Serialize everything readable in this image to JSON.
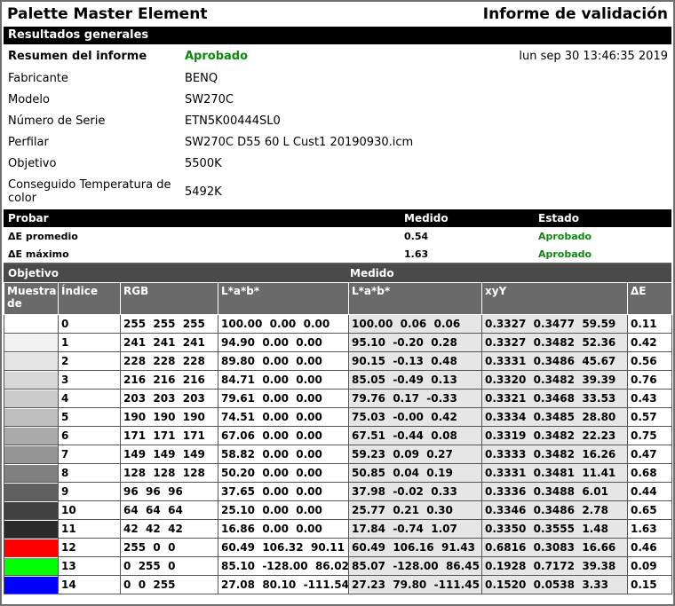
{
  "header": {
    "app_title": "Palette Master Element",
    "report_title": "Informe de validación"
  },
  "general": {
    "band_label": "Resultados generales",
    "summary_label": "Resumen del informe",
    "summary_status": "Aprobado",
    "date": "lun sep 30 13:46:35 2019",
    "fields": [
      {
        "label": "Fabricante",
        "value": "BENQ"
      },
      {
        "label": "Modelo",
        "value": "SW270C"
      },
      {
        "label": "Número de Serie",
        "value": "ETN5K00444SL0"
      },
      {
        "label": "Perfilar",
        "value": "SW270C D55 60 L Cust1 20190930.icm"
      },
      {
        "label": "Objetivo",
        "value": "5500K"
      },
      {
        "label": "Conseguido Temperatura de color",
        "value": "5492K"
      }
    ]
  },
  "tests": {
    "headers": {
      "test": "Probar",
      "measured": "Medido",
      "status": "Estado"
    },
    "rows": [
      {
        "name": "ΔE promedio",
        "measured": "0.54",
        "status": "Aprobado"
      },
      {
        "name": "ΔE máximo",
        "measured": "1.63",
        "status": "Aprobado"
      }
    ]
  },
  "samples": {
    "group_target": "Objetivo",
    "group_measured": "Medido",
    "columns": [
      "Muestra de",
      "Índice",
      "RGB",
      "L*a*b*",
      "L*a*b*",
      "xyY",
      "ΔE"
    ],
    "colors": {
      "red": "#ff0000",
      "green": "#00ff00",
      "blue": "#0000ff"
    },
    "rows": [
      {
        "swatch": "#ffffff",
        "index": "0",
        "rgb": "255  255  255",
        "lab_t": "100.00  0.00  0.00",
        "lab_m": "100.00  0.06  0.06",
        "xyy": "0.3327  0.3477  59.59",
        "de": "0.11"
      },
      {
        "swatch": "#f1f1f1",
        "index": "1",
        "rgb": "241  241  241",
        "lab_t": "94.90  0.00  0.00",
        "lab_m": "95.10  -0.20  0.28",
        "xyy": "0.3327  0.3482  52.36",
        "de": "0.42"
      },
      {
        "swatch": "#e4e4e4",
        "index": "2",
        "rgb": "228  228  228",
        "lab_t": "89.80  0.00  0.00",
        "lab_m": "90.15  -0.13  0.48",
        "xyy": "0.3331  0.3486  45.67",
        "de": "0.56"
      },
      {
        "swatch": "#d8d8d8",
        "index": "3",
        "rgb": "216  216  216",
        "lab_t": "84.71  0.00  0.00",
        "lab_m": "85.05  -0.49  0.13",
        "xyy": "0.3320  0.3482  39.39",
        "de": "0.76"
      },
      {
        "swatch": "#cbcbcb",
        "index": "4",
        "rgb": "203  203  203",
        "lab_t": "79.61  0.00  0.00",
        "lab_m": "79.76  0.17  -0.33",
        "xyy": "0.3321  0.3468  33.53",
        "de": "0.43"
      },
      {
        "swatch": "#bebebe",
        "index": "5",
        "rgb": "190  190  190",
        "lab_t": "74.51  0.00  0.00",
        "lab_m": "75.03  -0.00  0.42",
        "xyy": "0.3334  0.3485  28.80",
        "de": "0.57"
      },
      {
        "swatch": "#ababab",
        "index": "6",
        "rgb": "171  171  171",
        "lab_t": "67.06  0.00  0.00",
        "lab_m": "67.51  -0.44  0.08",
        "xyy": "0.3319  0.3482  22.23",
        "de": "0.75"
      },
      {
        "swatch": "#959595",
        "index": "7",
        "rgb": "149  149  149",
        "lab_t": "58.82  0.00  0.00",
        "lab_m": "59.23  0.09  0.27",
        "xyy": "0.3333  0.3482  16.26",
        "de": "0.47"
      },
      {
        "swatch": "#808080",
        "index": "8",
        "rgb": "128  128  128",
        "lab_t": "50.20  0.00  0.00",
        "lab_m": "50.85  0.04  0.19",
        "xyy": "0.3331  0.3481  11.41",
        "de": "0.68"
      },
      {
        "swatch": "#606060",
        "index": "9",
        "rgb": "96  96  96",
        "lab_t": "37.65  0.00  0.00",
        "lab_m": "37.98  -0.02  0.33",
        "xyy": "0.3336  0.3488  6.01",
        "de": "0.44"
      },
      {
        "swatch": "#404040",
        "index": "10",
        "rgb": "64  64  64",
        "lab_t": "25.10  0.00  0.00",
        "lab_m": "25.77  0.21  0.30",
        "xyy": "0.3346  0.3486  2.78",
        "de": "0.65"
      },
      {
        "swatch": "#2a2a2a",
        "index": "11",
        "rgb": "42  42  42",
        "lab_t": "16.86  0.00  0.00",
        "lab_m": "17.84  -0.74  1.07",
        "xyy": "0.3350  0.3555  1.48",
        "de": "1.63"
      },
      {
        "swatch": "#ff0000",
        "index": "12",
        "rgb": "255  0  0",
        "lab_t": "60.49  106.32  90.11",
        "lab_m": "60.49  106.16  91.43",
        "xyy": "0.6816  0.3083  16.66",
        "de": "0.46"
      },
      {
        "swatch": "#00ff00",
        "index": "13",
        "rgb": "0  255  0",
        "lab_t": "85.10  -128.00  86.02",
        "lab_m": "85.07  -128.00  86.45",
        "xyy": "0.1928  0.7172  39.38",
        "de": "0.09"
      },
      {
        "swatch": "#0000ff",
        "index": "14",
        "rgb": "0  0  255",
        "lab_t": "27.08  80.10  -111.54",
        "lab_m": "27.23  79.80  -111.45",
        "xyy": "0.1520  0.0538  3.33",
        "de": "0.15"
      }
    ]
  }
}
